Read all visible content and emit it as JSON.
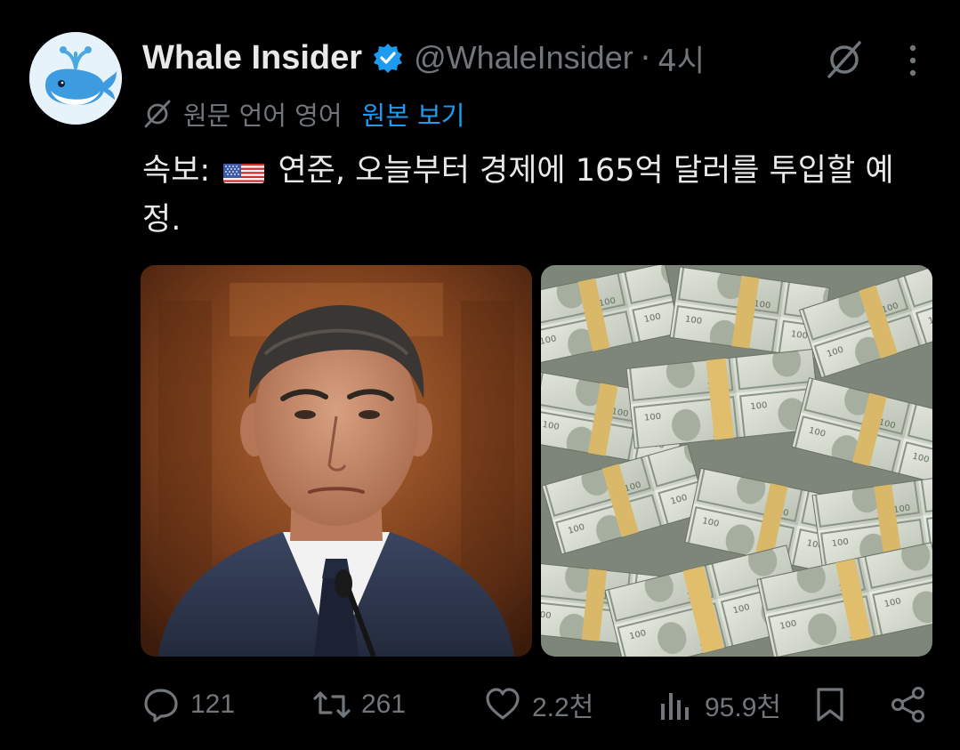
{
  "author": {
    "display_name": "Whale Insider",
    "handle": "@WhaleInsider",
    "separator": "·",
    "time": "4시",
    "verified": true,
    "avatar_icon": "whale-icon"
  },
  "translation": {
    "source_language_label": "원문 언어 영어",
    "show_original_label": "원본 보기"
  },
  "post": {
    "text_prefix": "속보: ",
    "text_flag": "us-flag-icon",
    "text_body": " 연준, 오늘부터 경제에 165억 달러를 투입할 예정."
  },
  "media": [
    {
      "description_icon": "man-portrait-photo"
    },
    {
      "description_icon": "cash-stacks-photo"
    }
  ],
  "actions": {
    "replies": "121",
    "reposts": "261",
    "likes": "2.2천",
    "views": "95.9천"
  },
  "colors": {
    "background": "#000000",
    "text": "#e7e9ea",
    "muted": "#71767b",
    "link": "#1d9bf0"
  }
}
